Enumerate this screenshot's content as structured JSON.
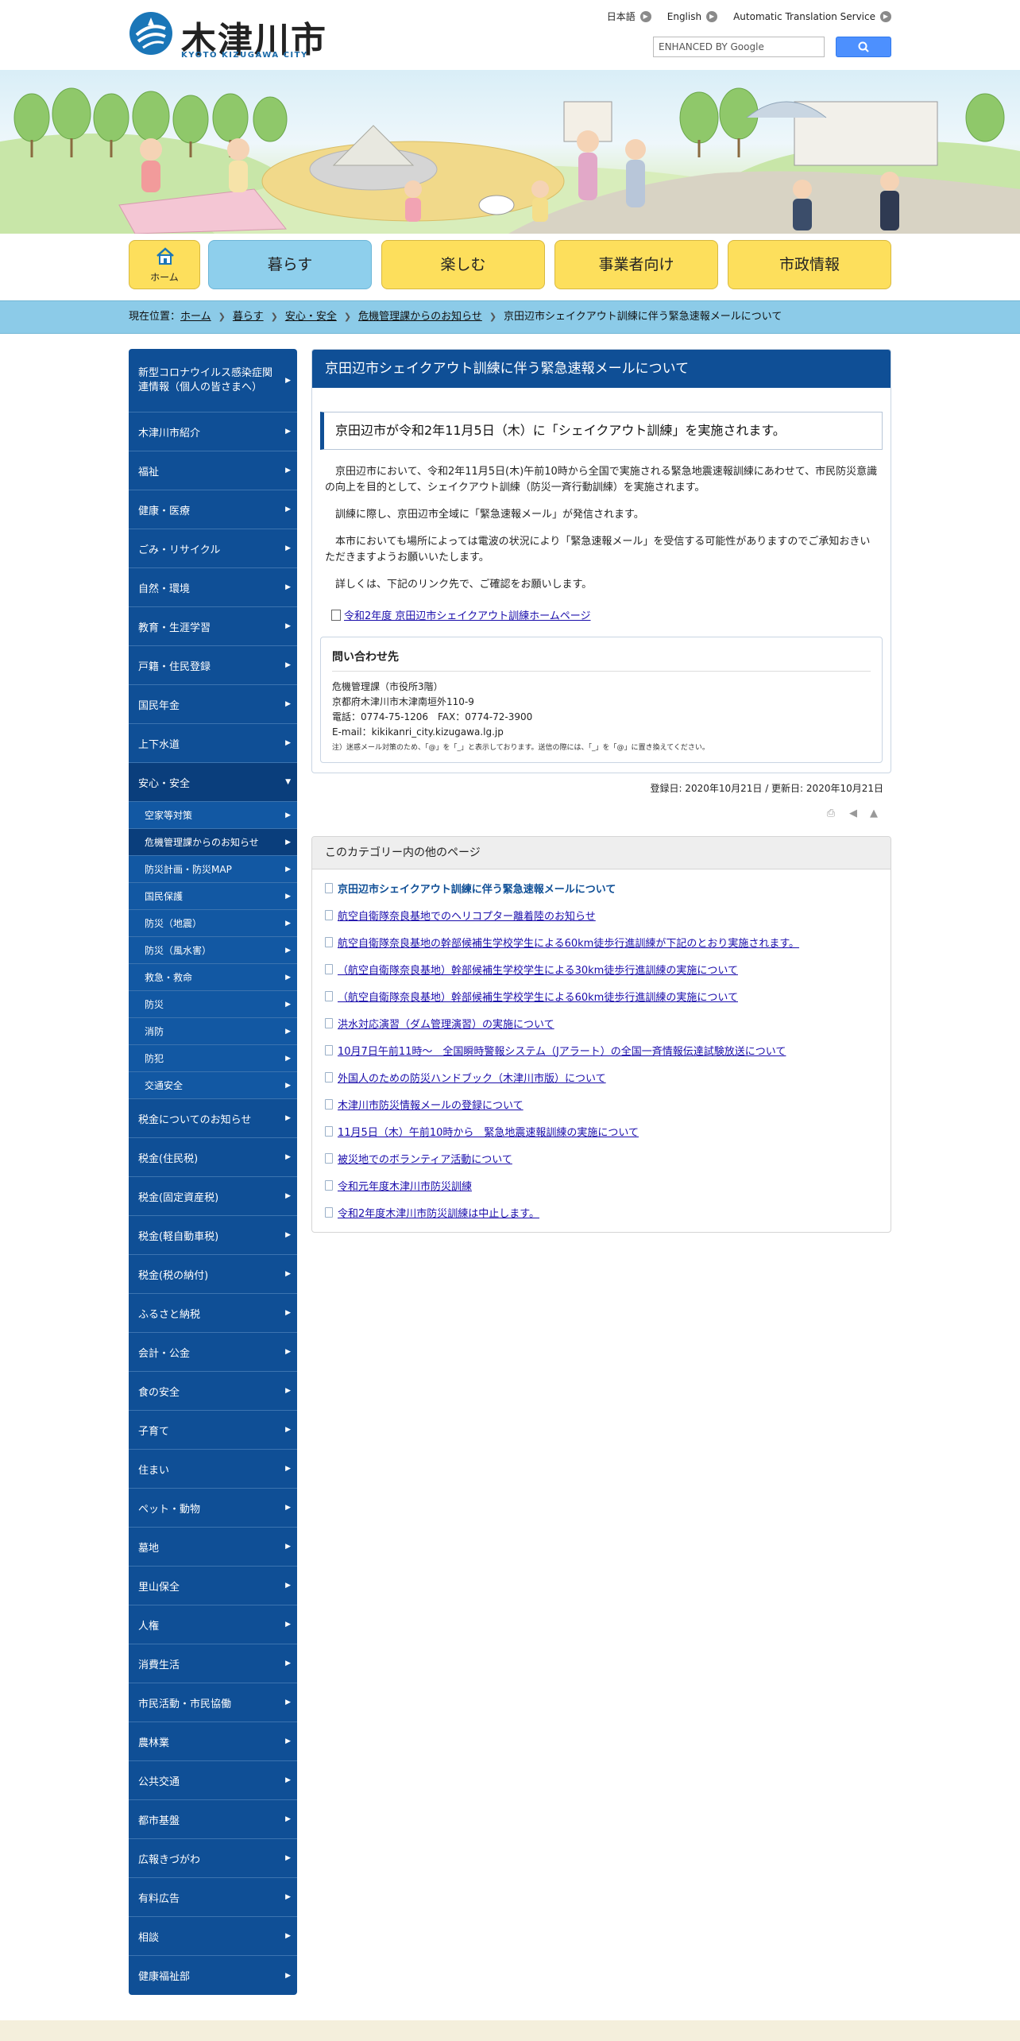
{
  "header": {
    "logo_text": "木津川市",
    "logo_sub": "KYOTO KIZUGAWA CITY",
    "lang_links": [
      "日本語",
      "English",
      "Automatic Translation Service"
    ],
    "search_placeholder": "ENHANCED BY Google"
  },
  "nav": {
    "home": "ホーム",
    "items": [
      "暮らす",
      "楽しむ",
      "事業者向け",
      "市政情報"
    ],
    "active_color": "#8ecfec",
    "default_color": "#fddf5c"
  },
  "breadcrumb": {
    "prefix": "現在位置：",
    "items": [
      "ホーム",
      "暮らす",
      "安心・安全",
      "危機管理課からのお知らせ",
      "京田辺市シェイクアウト訓練に伴う緊急速報メールについて"
    ]
  },
  "sidebar": {
    "items": [
      "新型コロナウイルス感染症関連情報（個人の皆さまへ）",
      "木津川市紹介",
      "福祉",
      "健康・医療",
      "ごみ・リサイクル",
      "自然・環境",
      "教育・生涯学習",
      "戸籍・住民登録",
      "国民年金",
      "上下水道",
      "安心・安全",
      "税金についてのお知らせ",
      "税金(住民税)",
      "税金(固定資産税)",
      "税金(軽自動車税)",
      "税金(税の納付)",
      "ふるさと納税",
      "会計・公金",
      "食の安全",
      "子育て",
      "住まい",
      "ペット・動物",
      "墓地",
      "里山保全",
      "人権",
      "消費生活",
      "市民活動・市民協働",
      "農林業",
      "公共交通",
      "都市基盤",
      "広報きづがわ",
      "有料広告",
      "相談",
      "健康福祉部"
    ],
    "sub_items": [
      "空家等対策",
      "危機管理課からのお知らせ",
      "防災計画・防災MAP",
      "国民保護",
      "防災（地震）",
      "防災（風水害）",
      "救急・救命",
      "防災",
      "消防",
      "防犯",
      "交通安全"
    ]
  },
  "article": {
    "title": "京田辺市シェイクアウト訓練に伴う緊急速報メールについて",
    "lead": "京田辺市が令和2年11月5日（木）に「シェイクアウト訓練」を実施されます。",
    "paragraphs": [
      "京田辺市において、令和2年11月5日(木)午前10時から全国で実施される緊急地震速報訓練にあわせて、市民防災意識の向上を目的として、シェイクアウト訓練（防災一斉行動訓練）を実施されます。",
      "訓練に際し、京田辺市全域に「緊急速報メール」が発信されます。",
      "本市においても場所によっては電波の状況により「緊急速報メール」を受信する可能性がありますのでご承知おきいただきますようお願いいたします。",
      "詳しくは、下記のリンク先で、ご確認をお願いします。"
    ],
    "link": "令和2年度 京田辺市シェイクアウト訓練ホームページ"
  },
  "contact": {
    "title": "問い合わせ先",
    "lines": [
      "危機管理課（市役所3階）",
      "京都府木津川市木津南垣外110-9",
      "電話：0774-75-1206　FAX：0774-72-3900",
      "E-mail：kikikanri_city.kizugawa.lg.jp"
    ],
    "note": "注）迷惑メール対策のため、「@」を「_」と表示しております。送信の際には、「_」を「@」に置き換えてください。"
  },
  "dates": "登録日: 2020年10月21日 /  更新日: 2020年10月21日",
  "related": {
    "title": "このカテゴリー内の他のページ",
    "items": [
      "京田辺市シェイクアウト訓練に伴う緊急速報メールについて",
      "航空自衛隊奈良基地でのヘリコプター離着陸のお知らせ",
      "航空自衛隊奈良基地の幹部候補生学校学生による60km徒歩行進訓練が下記のとおり実施されます。",
      "（航空自衛隊奈良基地）幹部候補生学校学生による30km徒歩行進訓練の実施について",
      "（航空自衛隊奈良基地）幹部候補生学校学生による60km徒歩行進訓練の実施について",
      "洪水対応演習（ダム管理演習）の実施について",
      "10月7日午前11時～　全国瞬時警報システム（Jアラート）の全国一斉情報伝達試験放送について",
      "外国人のための防災ハンドブック（木津川市版）について",
      "木津川市防災情報メールの登録について",
      "11月5日（木）午前10時から　緊急地震速報訓練の実施について",
      "被災地でのボランティア活動について",
      "令和元年度木津川市防災訓練",
      "令和2年度木津川市防災訓練は中止します。"
    ]
  }
}
